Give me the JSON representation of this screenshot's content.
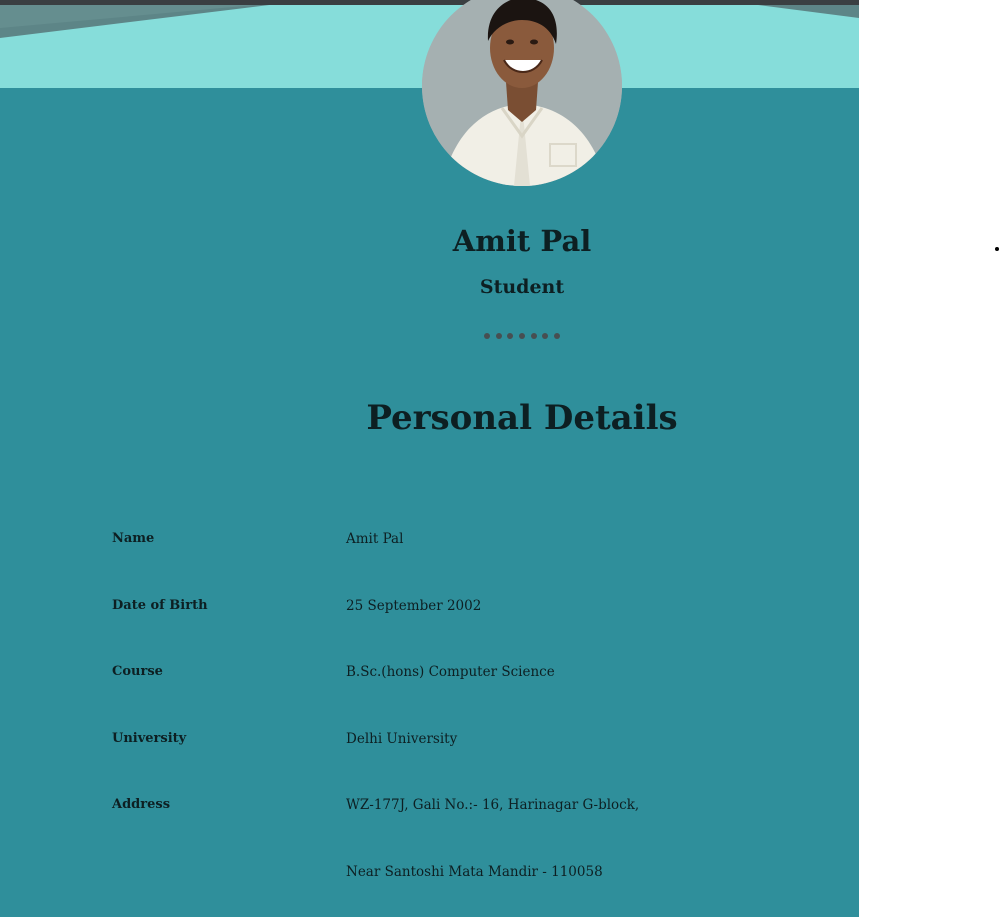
{
  "profile": {
    "name": "Amit Pal",
    "role": "Student",
    "photo_icon": "profile-photo"
  },
  "section_title": "Personal Details",
  "details": [
    {
      "label": "Name",
      "value": "Amit Pal"
    },
    {
      "label": "Date of Birth",
      "value": "25 September 2002"
    },
    {
      "label": "Course",
      "value": "B.Sc.(hons) Computer Science"
    },
    {
      "label": "University",
      "value": "Delhi University"
    },
    {
      "label": "Address",
      "value": "WZ-177J, Gali No.:- 16, Harinagar G-block,"
    },
    {
      "label": "",
      "value": "Near Santoshi Mata Mandir - 110058"
    }
  ],
  "colors": {
    "page_background": "#2f8f9b",
    "banner": "#86ddda",
    "text": "#0d1f22"
  }
}
